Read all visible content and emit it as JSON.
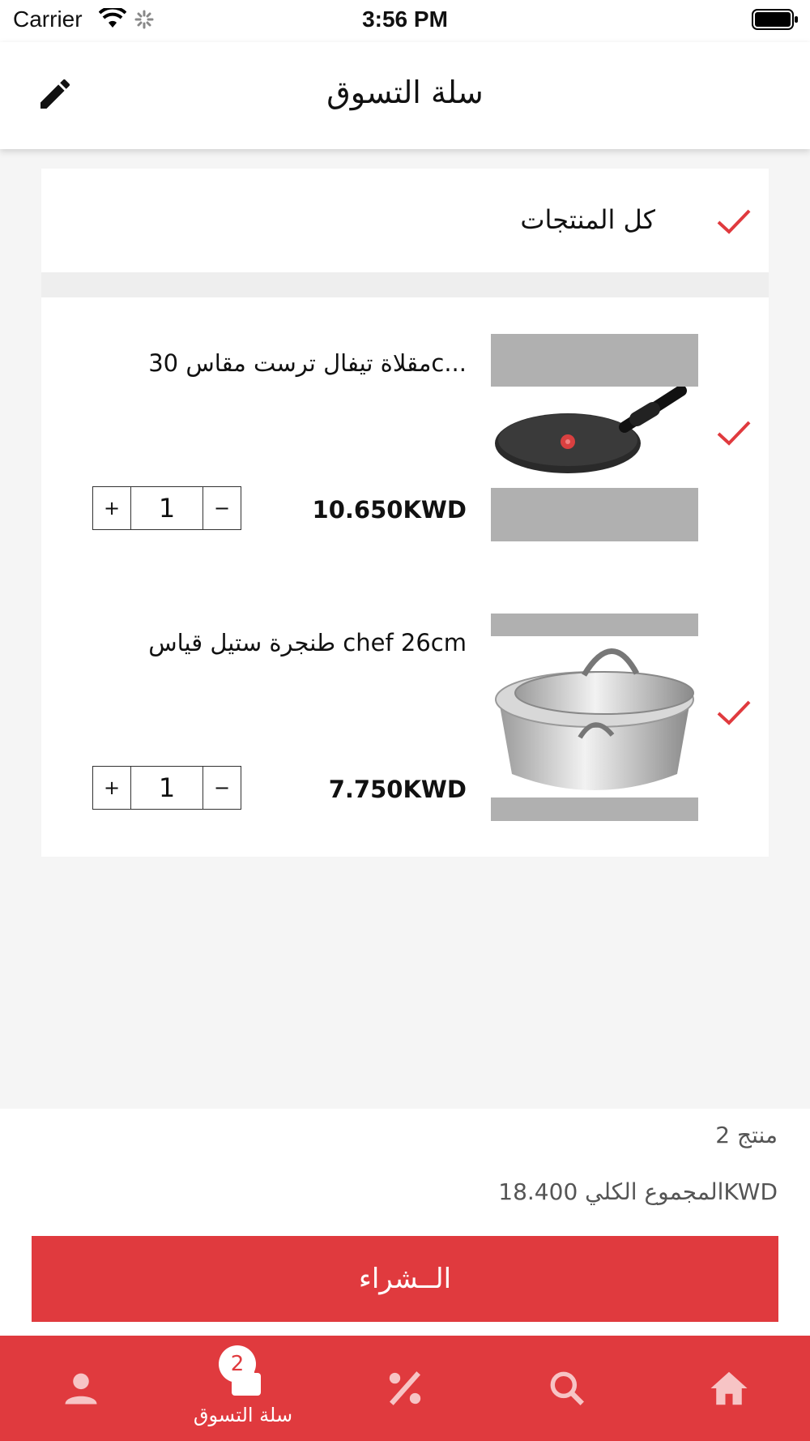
{
  "status_bar": {
    "carrier": "Carrier",
    "time": "3:56 PM"
  },
  "header": {
    "title": "سلة التسوق",
    "edit_icon": "pencil-icon"
  },
  "cart": {
    "select_all_label": "كل المنتجات",
    "items": [
      {
        "name": "مقلاة تيفال ترست مقاس 30c...",
        "price": "10.650KWD",
        "quantity": "1",
        "plus": "+",
        "minus": "−",
        "checked": true
      },
      {
        "name": "طنجرة ستيل قياس chef 26cm",
        "price": "7.750KWD",
        "quantity": "1",
        "plus": "+",
        "minus": "−",
        "checked": true
      }
    ]
  },
  "summary": {
    "count": "2 منتج",
    "total": "المجموع الكلي 18.400KWD",
    "buy_label": "الــشراء"
  },
  "tabbar": {
    "active_label": "سلة التسوق",
    "cart_badge": "2",
    "tabs": [
      "profile-icon",
      "cart-icon",
      "percent-icon",
      "search-icon",
      "home-icon"
    ]
  },
  "colors": {
    "accent": "#e03a3e",
    "background": "#f5f5f5"
  }
}
